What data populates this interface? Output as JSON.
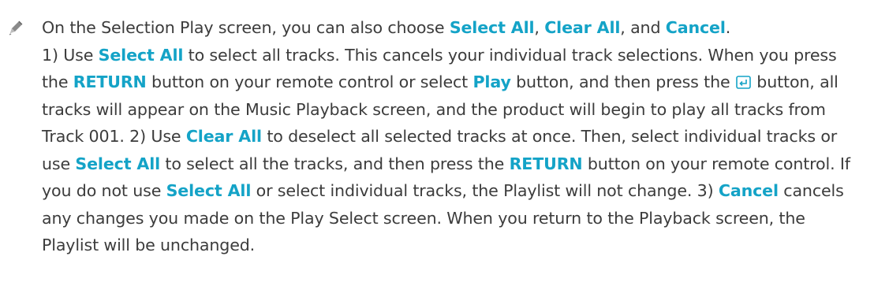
{
  "note": {
    "icon": "pencil-icon",
    "colors": {
      "text": "#3c3c3c",
      "keyword": "#14a3c7"
    },
    "segments": {
      "s0": "On the Selection Play screen, you can also choose ",
      "k_select_all_1": "Select All",
      "s1": ", ",
      "k_clear_all_1": "Clear All",
      "s2": ", and ",
      "k_cancel_1": "Cancel",
      "s3": ".",
      "s4": "1) Use ",
      "k_select_all_2": "Select All",
      "s5": " to select all tracks. This cancels your individual track selections. When you press the ",
      "k_return_1": "RETURN",
      "s6": " button on your remote control or select ",
      "k_play": "Play",
      "s7": " button, and then press the ",
      "s8": " button, all tracks will appear on the Music Playback screen, and the product will begin to play all tracks from Track 001. 2) Use ",
      "k_clear_all_2": "Clear All",
      "s9": " to deselect all selected tracks at once. Then, select individual tracks or use ",
      "k_select_all_3": "Select All",
      "s10": " to select all the tracks, and then press the ",
      "k_return_2": "RETURN",
      "s11": " button on your remote control. If you do not use ",
      "k_select_all_4": "Select All",
      "s12": " or select individual tracks, the Playlist will not change. 3) ",
      "k_cancel_2": "Cancel",
      "s13": " cancels any changes you made on the Play Select screen. When you return to the Playback screen, the Playlist will be unchanged."
    },
    "enter_icon": "enter-button-icon"
  }
}
